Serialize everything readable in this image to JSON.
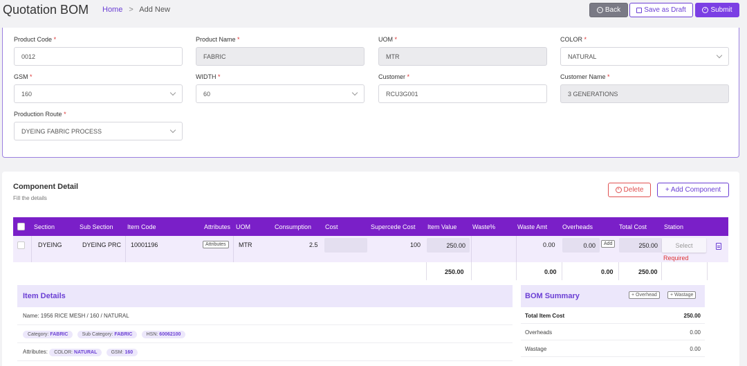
{
  "header": {
    "title": "Quotation BOM",
    "breadcrumb_home": "Home",
    "breadcrumb_sep": ">",
    "breadcrumb_current": "Add New",
    "back_label": "Back",
    "draft_label": "Save as Draft",
    "submit_label": "Submit"
  },
  "form": {
    "product_code": {
      "label": "Product Code",
      "value": "0012"
    },
    "product_name": {
      "label": "Product Name",
      "value": "FABRIC"
    },
    "uom": {
      "label": "UOM",
      "value": "MTR"
    },
    "color": {
      "label": "COLOR",
      "value": "NATURAL"
    },
    "gsm": {
      "label": "GSM",
      "value": "160"
    },
    "width": {
      "label": "WIDTH",
      "value": "60"
    },
    "customer": {
      "label": "Customer",
      "value": "RCU3G001"
    },
    "customer_name": {
      "label": "Customer Name",
      "value": "3 GENERATIONS"
    },
    "production_route": {
      "label": "Production Route",
      "value": "DYEING FABRIC PROCESS"
    },
    "required_mark": "*"
  },
  "component": {
    "title": "Component Detail",
    "subtitle": "Fill the details",
    "delete_label": "Delete",
    "add_label": "+ Add Component",
    "columns": [
      "Section",
      "Sub Section",
      "Item Code",
      "Attributes",
      "UOM",
      "Consumption",
      "Cost",
      "Supercede Cost",
      "Item Value",
      "Waste%",
      "Waste Amt",
      "Overheads",
      "Total Cost",
      "Station"
    ],
    "row": {
      "section": "DYEING",
      "sub_section": "DYEING PRC",
      "item_code": "10001196",
      "attributes_btn": "Attributes",
      "uom": "MTR",
      "consumption": "2.5",
      "cost": "",
      "supercede_cost": "100",
      "item_value": "250.00",
      "waste_pct": "",
      "waste_amt": "0.00",
      "overheads": "0.00",
      "add_btn": "Add",
      "total_cost": "250.00",
      "station_placeholder": "Select",
      "station_error": "Required"
    },
    "totals": {
      "item_value": "250.00",
      "waste_amt": "0.00",
      "overheads": "0.00",
      "total_cost": "250.00"
    }
  },
  "item_details": {
    "title": "Item Details",
    "name_label": "Name:",
    "name_value": "1956 RICE MESH / 160 / NATURAL",
    "category_label": "Category:",
    "category_value": "FABRIC",
    "subcategory_label": "Sub Category:",
    "subcategory_value": "FABRIC",
    "hsn_label": "HSN:",
    "hsn_value": "60062100",
    "attributes_label": "Attributes:",
    "color_label": "COLOR:",
    "color_value": "NATURAL",
    "gsm_label": "GSM:",
    "gsm_value": "160"
  },
  "bom_summary": {
    "title": "BOM Summary",
    "overhead_btn": "+ Overhead",
    "wastage_btn": "+ Wastage",
    "rows": [
      {
        "label": "Total Item Cost",
        "value": "250.00"
      },
      {
        "label": "Overheads",
        "value": "0.00"
      },
      {
        "label": "Wastage",
        "value": "0.00"
      }
    ]
  },
  "colors": {
    "accent": "#7b3fe4",
    "table_header": "#7a1fc8",
    "danger": "#e05050"
  }
}
